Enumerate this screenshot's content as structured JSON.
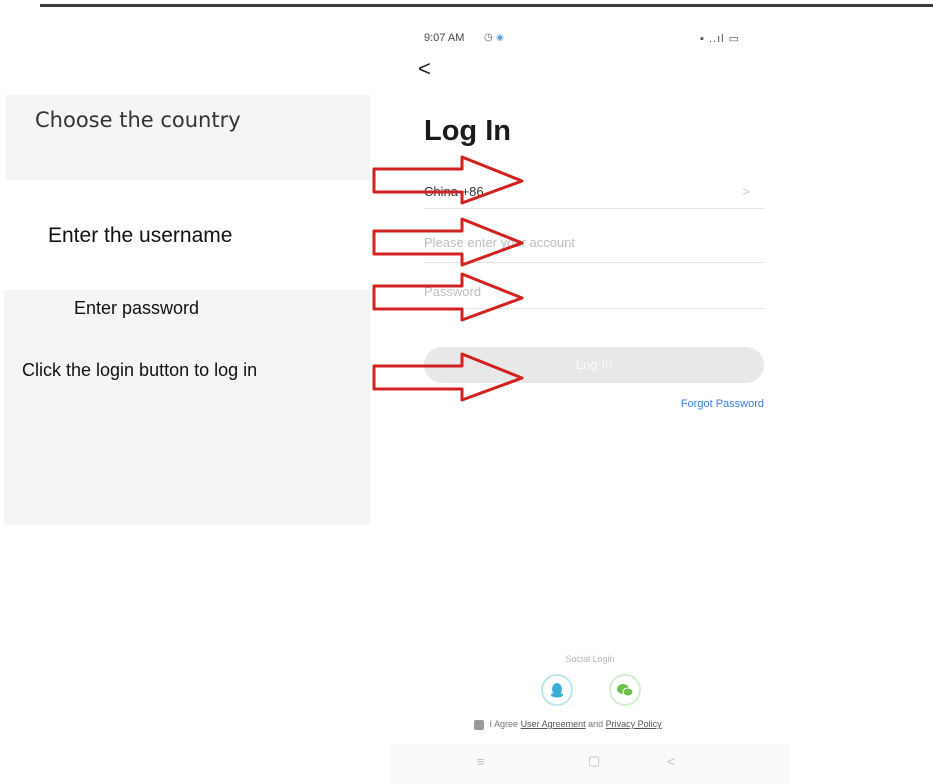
{
  "annotations": {
    "choose_country": "Choose the country",
    "enter_username": "Enter the username",
    "enter_password": "Enter password",
    "click_login": "Click the login button to log in"
  },
  "status_bar": {
    "time": "9:07 AM",
    "icons": "▪ ..ıl ▭"
  },
  "screen": {
    "back": "<",
    "title": "Log In",
    "country_value": "China +86",
    "country_chevron": ">",
    "account_placeholder": "Please enter your account",
    "password_placeholder": "Password",
    "login_button": "Log In",
    "forgot_password": "Forgot Password",
    "social_login_label": "Social Login",
    "agreement": {
      "prefix": "I Agree",
      "user_agreement": "User Agreement",
      "and": "and",
      "privacy_policy": "Privacy Policy"
    }
  },
  "nav_bar": {
    "menu": "≡",
    "home": "▢",
    "back": "<"
  },
  "colors": {
    "arrow": "#d32020",
    "link": "#3d7bd6",
    "qq": "#3aaed8",
    "wechat": "#6cc04a"
  }
}
